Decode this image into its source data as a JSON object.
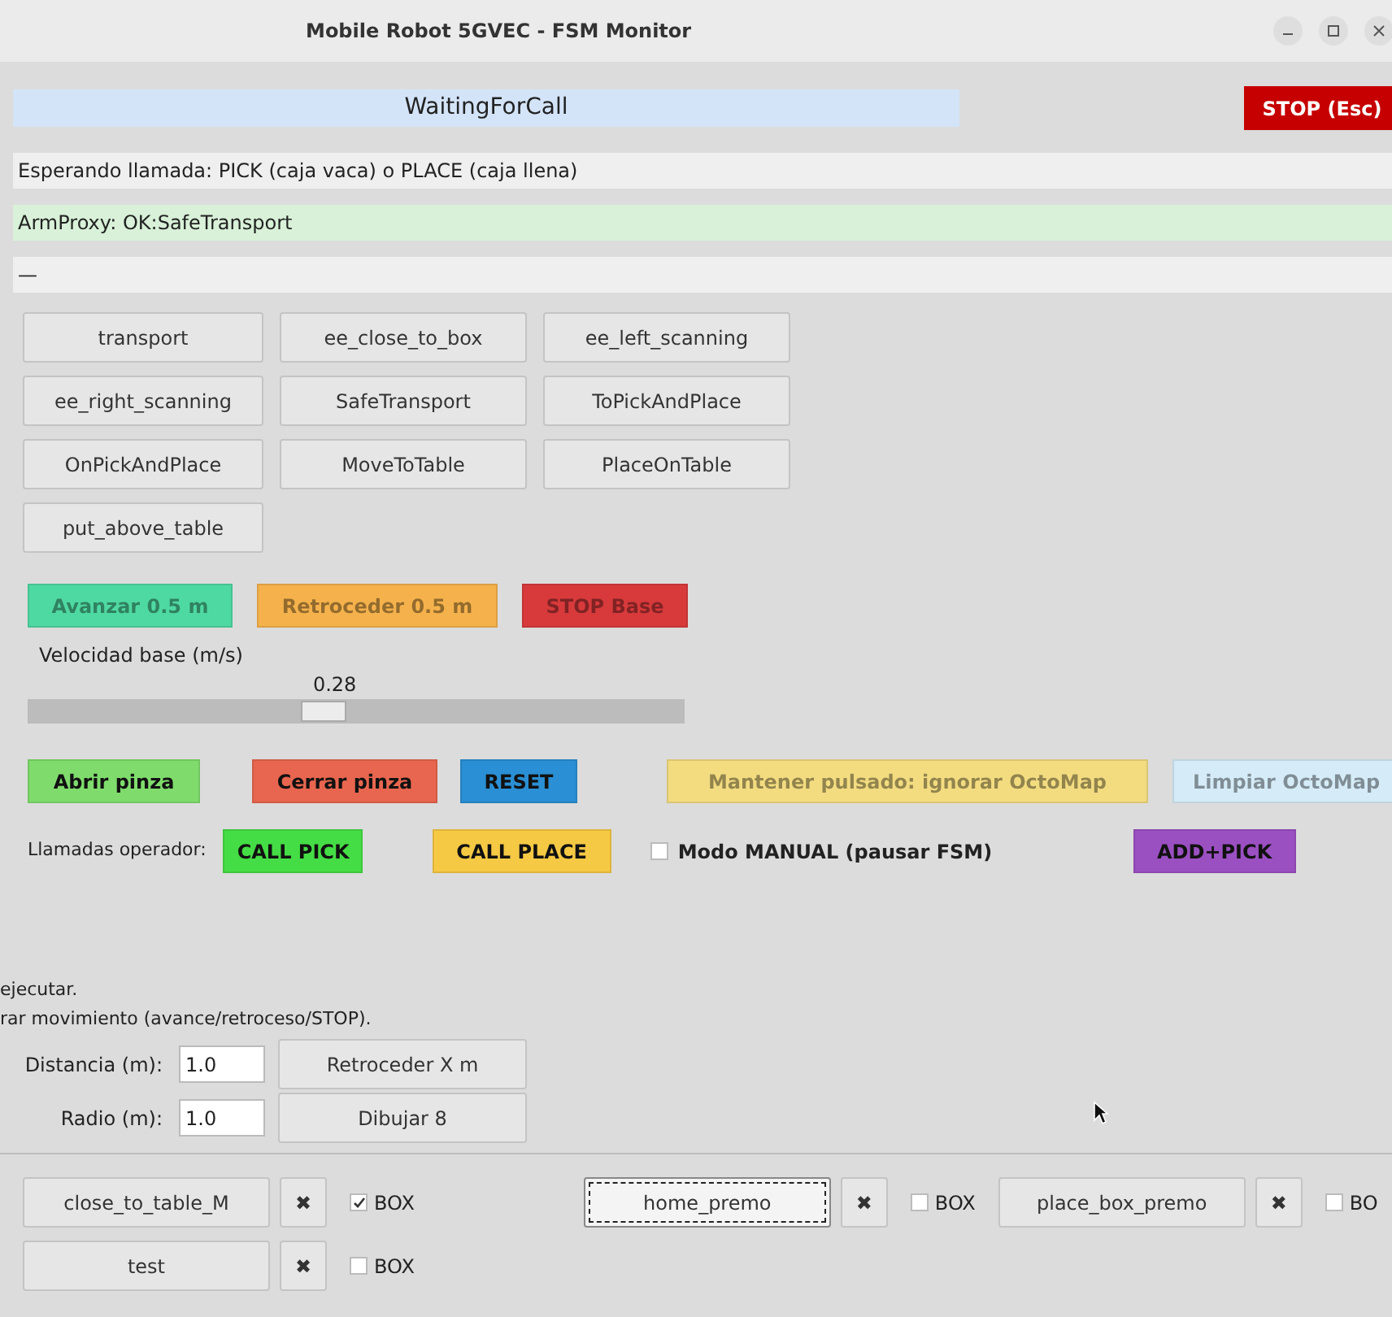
{
  "window": {
    "title": "Mobile Robot 5GVEC - FSM Monitor"
  },
  "state": "WaitingForCall",
  "stop_button": "STOP (Esc)",
  "status_lines": [
    {
      "text": "Esperando llamada: PICK (caja vaca) o PLACE (caja llena)",
      "kind": "info"
    },
    {
      "text": "ArmProxy: OK:SafeTransport",
      "kind": "ok"
    },
    {
      "text": "—",
      "kind": "info"
    }
  ],
  "state_buttons": [
    "transport",
    "ee_close_to_box",
    "ee_left_scanning",
    "ee_right_scanning",
    "SafeTransport",
    "ToPickAndPlace",
    "OnPickAndPlace",
    "MoveToTable",
    "PlaceOnTable",
    "put_above_table"
  ],
  "base_buttons": [
    {
      "label": "Avanzar 0.5 m",
      "color": "#4fd9a2",
      "disabled": true
    },
    {
      "label": "Retroceder 0.5 m",
      "color": "#f5b24c",
      "disabled": true
    },
    {
      "label": "STOP Base",
      "color": "#d83a3c",
      "disabled": true
    }
  ],
  "speed": {
    "label": "Velocidad base (m/s)",
    "reading": "0.28",
    "level": 0.45
  },
  "gripper_buttons": [
    {
      "label": "Abrir pinza",
      "color": "#7fdc6c",
      "disabled": false
    },
    {
      "label": "Cerrar pinza",
      "color": "#e8664f",
      "disabled": false
    },
    {
      "label": "RESET",
      "color": "#2a8fd4",
      "disabled": false
    },
    {
      "label": "Mantener pulsado: ignorar OctoMap",
      "color": "#f3dc80",
      "disabled": true
    },
    {
      "label": "Limpiar OctoMap",
      "color": "#d5ecf8",
      "disabled": true
    }
  ],
  "operator": {
    "label": "Llamadas operador:",
    "call_pick": {
      "label": "CALL PICK",
      "color": "#45dd45"
    },
    "call_place": {
      "label": "CALL PLACE",
      "color": "#f6c944"
    },
    "manual": {
      "label": "Modo MANUAL (pausar FSM)",
      "checked": false
    },
    "add_pick": {
      "label": "ADD+PICK",
      "color": "#9b50c2"
    }
  },
  "help_lines": [
    "ejecutar.",
    "rar movimiento (avance/retroceso/STOP)."
  ],
  "motion": [
    {
      "label": "Distancia (m):",
      "value": "1.0",
      "button": "Retroceder X m"
    },
    {
      "label": "Radio (m):",
      "value": "1.0",
      "button": "Dibujar 8"
    }
  ],
  "macros": [
    [
      {
        "name": "close_to_table_M",
        "delete": "✖",
        "box": "BOX",
        "checked": true,
        "focused": false
      },
      {
        "name": "home_premo",
        "delete": "✖",
        "box": "BOX",
        "checked": false,
        "focused": true
      },
      {
        "name": "place_box_premo",
        "delete": "✖",
        "box": "BO",
        "checked": false,
        "focused": false
      }
    ],
    [
      {
        "name": "test",
        "delete": "✖",
        "box": "BOX",
        "checked": false,
        "focused": false
      }
    ]
  ]
}
